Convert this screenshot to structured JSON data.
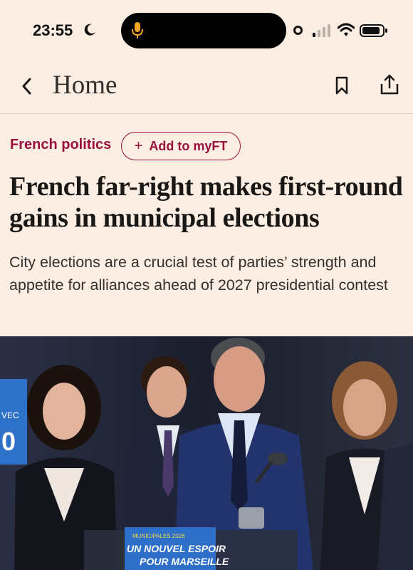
{
  "status_bar": {
    "time": "23:55",
    "icons": [
      "moon-icon",
      "microphone-icon",
      "recording-indicator",
      "cellular-signal-icon",
      "wifi-icon",
      "battery-icon"
    ]
  },
  "nav": {
    "back_icon": "chevron-left-icon",
    "title": "Home",
    "bookmark_icon": "bookmark-icon",
    "share_icon": "share-icon"
  },
  "article": {
    "topic": "French politics",
    "add_myft_plus": "+",
    "add_myft_label": "Add to myFT",
    "headline": "French far-right makes first-round gains in municipal elections",
    "standfirst": "City elections are a crucial test of parties’ strength and appetite for alliances ahead of 2027 presidential contest"
  },
  "hero_image": {
    "podium_sign_small": "MUNICIPALES 2026",
    "podium_sign_line1": "UN NOUVEL ESPOIR",
    "podium_sign_line2": "POUR MARSEILLE",
    "banner_left_text": "VEC"
  },
  "colors": {
    "background": "#FCEEE2",
    "accent": "#990F3D",
    "headline": "#1a1817"
  }
}
